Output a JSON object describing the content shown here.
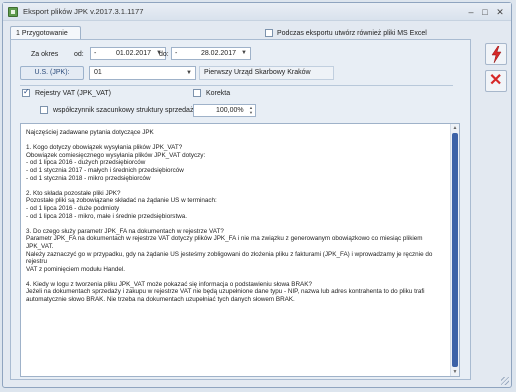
{
  "window": {
    "title": "Eksport plików JPK v.2017.3.1.1177",
    "minimize": "–",
    "maximize": "□",
    "close": "✕"
  },
  "tabs": [
    {
      "label": "1 Przygotowanie pliku JPK"
    }
  ],
  "top_option": {
    "label": "Podczas eksportu utwórz również pliki MS Excel",
    "checked": false
  },
  "period": {
    "label": "Za okres",
    "from_label": "od:",
    "from_value": "01.02.2017",
    "to_label": "do:",
    "to_value": "28.02.2017",
    "minus": "-"
  },
  "tax_office": {
    "button": "U.S. (JPK):",
    "code": "01",
    "name": "Pierwszy Urząd Skarbowy Kraków"
  },
  "options": {
    "vat_register": {
      "label": "Rejestry VAT (JPK_VAT)",
      "checked": true
    },
    "correction": {
      "label": "Korekta",
      "checked": false
    },
    "coefficient": {
      "label": "współczynnik szacunkowy struktury sprzedaży",
      "checked": false,
      "value": "100,00%"
    }
  },
  "memo": {
    "text": "Najczęściej zadawane pytania dotyczące JPK\n\n1. Kogo dotyczy obowiązek wysyłania plików JPK_VAT?\nObowiązek comiesięcznego wysyłania plików JPK_VAT dotyczy:\n- od 1 lipca 2016 - dużych przedsiębiorców\n- od 1 stycznia 2017 - małych i średnich przedsiębiorców\n- od 1 stycznia 2018 - mikro przedsiębiorców\n\n2. Kto składa pozostałe pliki JPK?\nPozostałe pliki są zobowiązane składać na żądanie US w terminach:\n- od 1 lipca 2016 - duże podmioty\n- od 1 lipca 2018 - mikro, małe i średnie przedsiębiorstwa.\n\n3. Do czego służy parametr JPK_FA na dokumentach w rejestrze VAT?\nParametr JPK_FA na dokumentach w rejestrze VAT dotyczy plików JPK_FA i nie ma związku z generowanym obowiązkowo co miesiąc plikiem JPK_VAT.\nNależy zaznaczyć go w przypadku, gdy na żądanie US jesteśmy zobligowani do złożenia pliku z fakturami (JPK_FA) i wprowadzamy je ręcznie do rejestru\nVAT z pominięciem modułu Handel.\n\n4. Kiedy w logu z tworzenia pliku JPK_VAT może pokazać się informacja o podstawieniu słowa BRAK?\nJeżeli na dokumentach sprzedaży i zakupu w rejestrze VAT nie będą uzupełnione dane typu - NIP, nazwa lub adres kontrahenta to do pliku trafi\nautomatycznie słowo BRAK. Nie trzeba na dokumentach uzupełniać tych danych słowem BRAK."
  },
  "icons": {
    "run": "lightning-icon",
    "cancel": "close-icon"
  },
  "colors": {
    "accent": "#3d63a8",
    "run_bolt": "#d62828",
    "cancel_cross": "#d62828"
  }
}
